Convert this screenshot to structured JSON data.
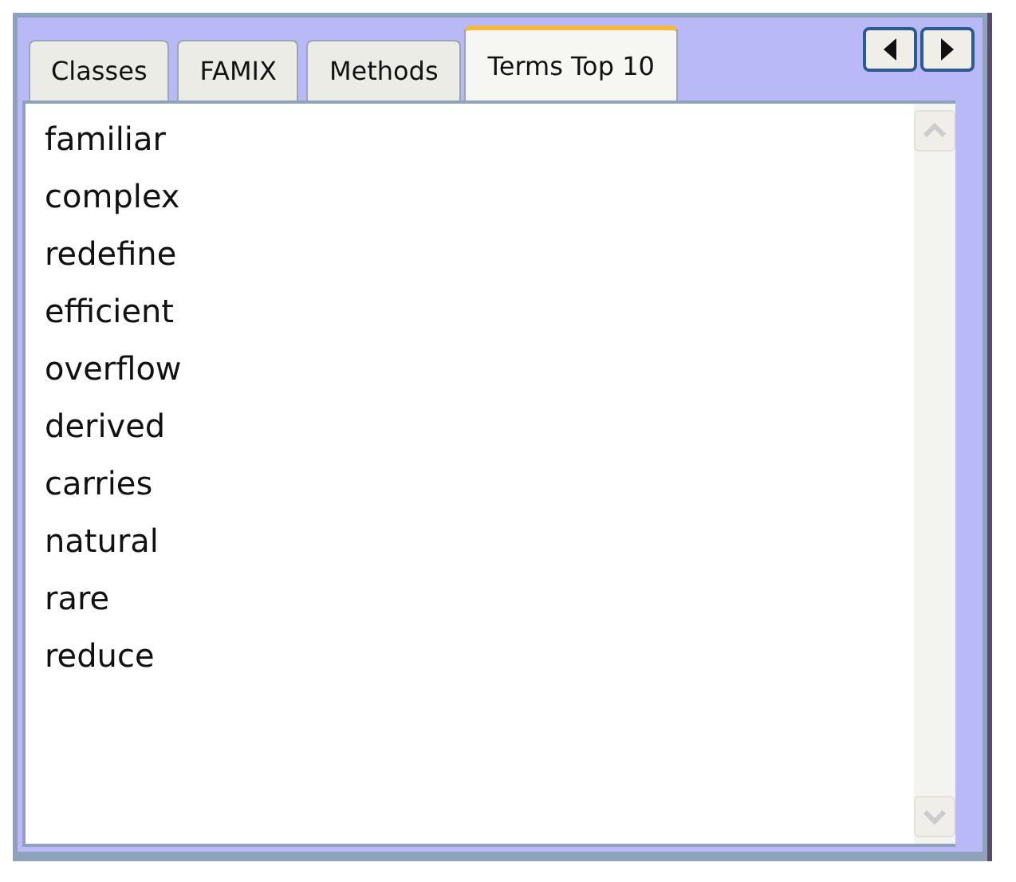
{
  "tabs": [
    {
      "label": "Classes",
      "selected": false
    },
    {
      "label": "FAMIX",
      "selected": false
    },
    {
      "label": "Methods",
      "selected": false
    },
    {
      "label": "Terms Top 10",
      "selected": true
    }
  ],
  "terms": [
    "familiar",
    "complex",
    "redefine",
    "efficient",
    "overflow",
    "derived",
    "carries",
    "natural",
    "rare",
    "reduce"
  ]
}
